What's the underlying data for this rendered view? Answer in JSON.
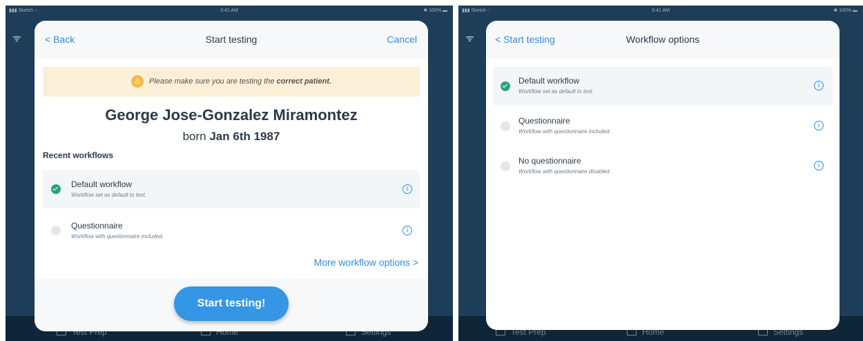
{
  "status_bar": {
    "carrier": "▮▮▮ Sketch ◌",
    "time": "9:41 AM",
    "battery": "✱ 100% ▬"
  },
  "tabbar": {
    "tabs": [
      {
        "label": "Test Prep"
      },
      {
        "label": "Home"
      },
      {
        "label": "Settings"
      }
    ]
  },
  "left": {
    "header": {
      "back_label": "< Back",
      "title": "Start testing",
      "cancel_label": "Cancel"
    },
    "warning": {
      "text": "Please make sure you are testing the ",
      "emphasis": "correct patient."
    },
    "patient": {
      "name": "George Jose-Gonzalez Miramontez",
      "born_prefix": "born ",
      "born_date": "Jan 6th 1987"
    },
    "section_title": "Recent workflows",
    "workflows": [
      {
        "name": "Default workflow",
        "desc": "Workflow set as default to test.",
        "selected": true
      },
      {
        "name": "Questionnaire",
        "desc": "Workflow with questionnaire included.",
        "selected": false
      }
    ],
    "more_link": "More workflow options  >",
    "start_button": "Start testing!"
  },
  "right": {
    "header": {
      "back_label": "< Start testing",
      "title": "Workflow options"
    },
    "workflows": [
      {
        "name": "Default workflow",
        "desc": "Workflow set as default to test.",
        "selected": true
      },
      {
        "name": "Questionnaire",
        "desc": "Workflow with questionnaire included.",
        "selected": false
      },
      {
        "name": "No questionnaire",
        "desc": "Workflow with questionnaire disabled.",
        "selected": false
      }
    ]
  },
  "colors": {
    "accent": "#2f8ee0",
    "check": "#2aa37f",
    "warning_bg": "#fcefd8",
    "background": "#1e3d58"
  }
}
